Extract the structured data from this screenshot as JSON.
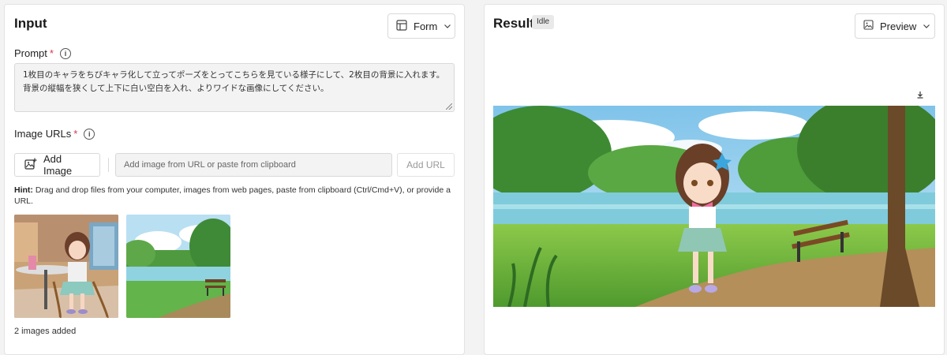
{
  "input": {
    "title": "Input",
    "mode_label": "Form",
    "prompt_label": "Prompt",
    "required_mark": "*",
    "prompt_value": "1枚目のキャラをちびキャラ化して立ってポーズをとってこちらを見ている様子にして、2枚目の背景に入れます。背景の縦幅を狭くして上下に白い空白を入れ、よりワイドな画像にしてください。",
    "image_urls_label": "Image URLs",
    "add_image_label": "Add Image",
    "url_placeholder": "Add image from URL or paste from clipboard",
    "add_url_label": "Add URL",
    "hint_prefix": "Hint:",
    "hint_text": " Drag and drop files from your computer, images from web pages, paste from clipboard (Ctrl/Cmd+V), or provide a URL.",
    "images_count_text": "2 images added"
  },
  "result": {
    "title": "Result",
    "status": "Idle",
    "view_label": "Preview"
  },
  "icons": {
    "form": "layout-icon",
    "chevron": "chevron-down-icon",
    "info": "info-icon",
    "add_image": "image-add-icon",
    "preview": "image-icon",
    "download": "download-icon"
  },
  "colors": {
    "required": "#d9364c",
    "panel_bg": "#ffffff",
    "page_bg": "#f3f3f3"
  }
}
